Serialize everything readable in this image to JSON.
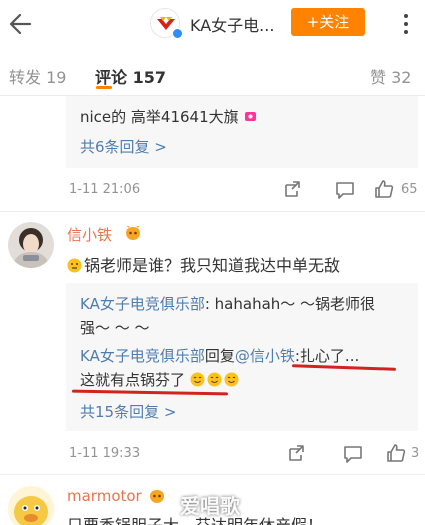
{
  "header": {
    "account_name": "KA女子电...",
    "follow_label": "+关注"
  },
  "tabs": {
    "repost": "转发 19",
    "comments": "评论 157",
    "likes": "赞 32"
  },
  "comments": [
    {
      "reply_snippet": "nice的 高举41641大旗",
      "reply_count": "共6条回复 >",
      "time": "1-11 21:06",
      "likes": "65"
    },
    {
      "username": "信小铁",
      "text": "锅老师是谁？我只知道我达中单无敌",
      "replies": [
        {
          "author": "KA女子电竞俱乐部",
          "text_line1": ": hahahah～ ～锅老师很",
          "text_line2": "强～ ～ ～"
        },
        {
          "author": "KA女子电竞俱乐部",
          "reply_word": "回复",
          "mention": "@信小铁",
          "text_line1": ":扎心了...",
          "text_line2": "这就有点锅芬了"
        }
      ],
      "reply_count": "共15条回复 >",
      "time": "1-11 19:33",
      "likes": "3"
    },
    {
      "username": "marmotor",
      "text": "只要香锅胆子大，芬达明年休产假！"
    }
  ],
  "watermark": "爱唱歌",
  "colors": {
    "accent": "#ff8200",
    "link": "#507daf",
    "username": "#eb7350",
    "underline_mark": "#d2241f"
  }
}
